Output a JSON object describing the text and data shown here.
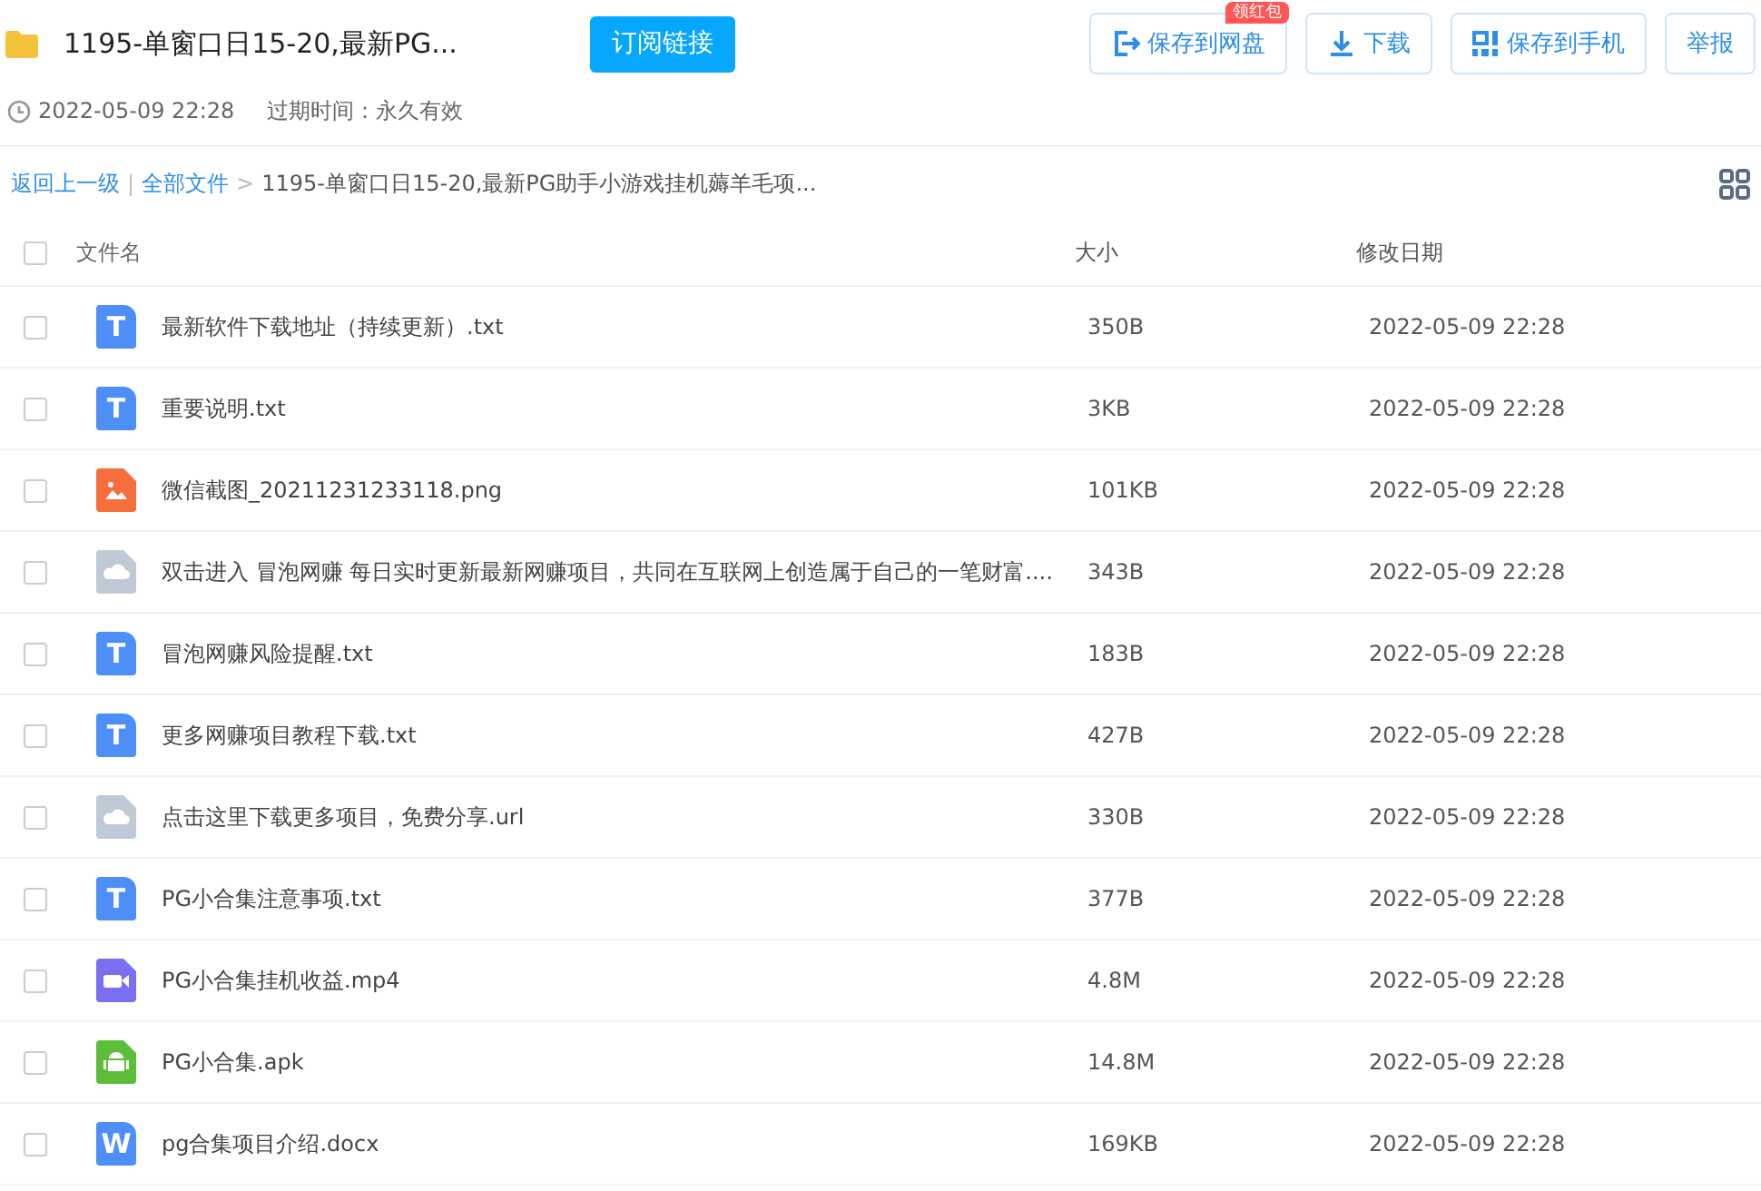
{
  "header": {
    "title": "1195-单窗口日15-20,最新PG...",
    "subscribe_button": "订阅链接",
    "actions": [
      {
        "kind": "save",
        "label": "保存到网盘",
        "badge": "领红包"
      },
      {
        "kind": "download",
        "label": "下载"
      },
      {
        "kind": "phone",
        "label": "保存到手机"
      },
      {
        "kind": "plain",
        "label": "举报"
      }
    ]
  },
  "meta": {
    "date": "2022-05-09 22:28",
    "expiry": "过期时间：永久有效"
  },
  "breadcrumb": {
    "back": "返回上一级",
    "separator": "|",
    "root": "全部文件",
    "arrow": ">",
    "current": "1195-单窗口日15-20,最新PG助手小游戏挂机薅羊毛项..."
  },
  "table": {
    "columns": [
      "文件名",
      "大小",
      "修改日期"
    ],
    "all_checked": false,
    "rows": [
      {
        "kind": "text",
        "icon_text": "T",
        "name": "最新软件下载地址（持续更新）.txt",
        "size": "350B",
        "date": "2022-05-09 22:28",
        "checked": false
      },
      {
        "kind": "text",
        "icon_text": "T",
        "name": "重要说明.txt",
        "size": "3KB",
        "date": "2022-05-09 22:28",
        "checked": false
      },
      {
        "kind": "image",
        "name": "微信截图_20211231233118.png",
        "size": "101KB",
        "date": "2022-05-09 22:28",
        "checked": false
      },
      {
        "kind": "other",
        "name": "双击进入 冒泡网赚 每日实时更新最新网赚项目，共同在互联网上创造属于自己的一笔财富....",
        "size": "343B",
        "date": "2022-05-09 22:28",
        "checked": false
      },
      {
        "kind": "text",
        "icon_text": "T",
        "name": "冒泡网赚风险提醒.txt",
        "size": "183B",
        "date": "2022-05-09 22:28",
        "checked": false
      },
      {
        "kind": "text",
        "icon_text": "T",
        "name": "更多网赚项目教程下载.txt",
        "size": "427B",
        "date": "2022-05-09 22:28",
        "checked": false
      },
      {
        "kind": "other",
        "name": "点击这里下载更多项目，免费分享.url",
        "size": "330B",
        "date": "2022-05-09 22:28",
        "checked": false
      },
      {
        "kind": "text",
        "icon_text": "T",
        "name": "PG小合集注意事项.txt",
        "size": "377B",
        "date": "2022-05-09 22:28",
        "checked": false
      },
      {
        "kind": "video",
        "name": "PG小合集挂机收益.mp4",
        "size": "4.8M",
        "date": "2022-05-09 22:28",
        "checked": false
      },
      {
        "kind": "apk",
        "name": "PG小合集.apk",
        "size": "14.8M",
        "date": "2022-05-09 22:28",
        "checked": false
      },
      {
        "kind": "word",
        "icon_text": "W",
        "name": "pg合集项目介绍.docx",
        "size": "169KB",
        "date": "2022-05-09 22:28",
        "checked": false
      }
    ]
  }
}
